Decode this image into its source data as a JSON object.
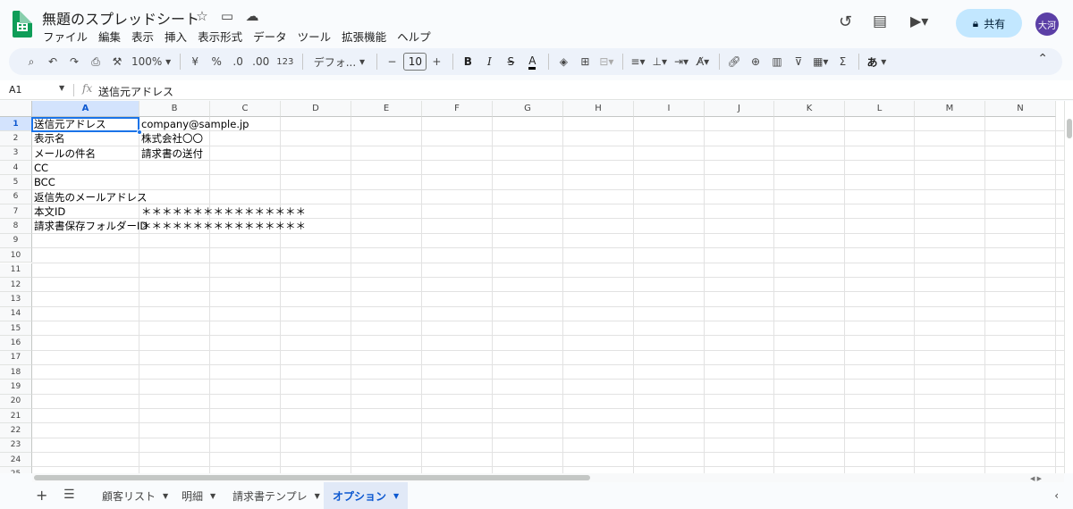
{
  "header": {
    "title": "無題のスプレッドシート",
    "menu": [
      "ファイル",
      "編集",
      "表示",
      "挿入",
      "表示形式",
      "データ",
      "ツール",
      "拡張機能",
      "ヘルプ"
    ],
    "share_label": "共有",
    "avatar_text": "大河"
  },
  "toolbar": {
    "zoom": "100%",
    "currency": "¥",
    "percent": "%",
    "dec_decrease": ".0",
    "dec_increase": ".00",
    "number_format": "123",
    "font": "デフォ...",
    "font_size": "10",
    "bold": "B",
    "italic": "I",
    "strike": "S",
    "text_color": "A",
    "sum": "Σ",
    "ime": "あ"
  },
  "formula_bar": {
    "name_box": "A1",
    "fx": "fx",
    "value": "送信元アドレス"
  },
  "grid": {
    "columns": [
      "A",
      "B",
      "C",
      "D",
      "E",
      "F",
      "G",
      "H",
      "I",
      "J",
      "K",
      "L",
      "M",
      "N"
    ],
    "row_count": 25,
    "cells": [
      {
        "a": "送信元アドレス",
        "b": "company@sample.jp"
      },
      {
        "a": "表示名",
        "b": "株式会社〇〇"
      },
      {
        "a": "メールの件名",
        "b": "請求書の送付"
      },
      {
        "a": "CC",
        "b": ""
      },
      {
        "a": "BCC",
        "b": ""
      },
      {
        "a": "返信先のメールアドレス",
        "b": ""
      },
      {
        "a": "本文ID",
        "b": "＊＊＊＊＊＊＊＊＊＊＊＊＊＊＊＊"
      },
      {
        "a": "請求書保存フォルダーID",
        "b": "＊＊＊＊＊＊＊＊＊＊＊＊＊＊＊＊"
      }
    ],
    "selected_cell": "A1"
  },
  "sheet_tabs": {
    "tabs": [
      "顧客リスト",
      "明細",
      "請求書テンプレ",
      "オプション"
    ],
    "active": "オプション"
  }
}
